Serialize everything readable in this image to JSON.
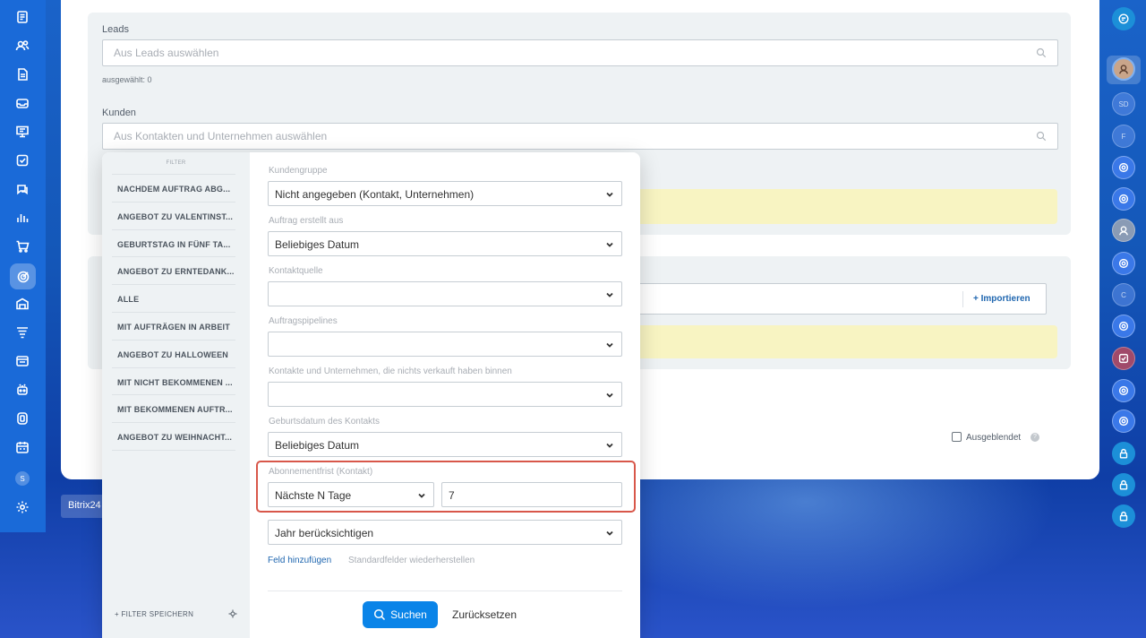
{
  "form": {
    "leads": {
      "label": "Leads",
      "placeholder": "Aus Leads auswählen",
      "selected": "ausgewählt: 0"
    },
    "kunden": {
      "label": "Kunden",
      "placeholder": "Aus Kontakten und Unternehmen auswählen"
    },
    "import_label": "+ Importieren",
    "hidden_label": "Ausgeblendet"
  },
  "bitrix_label": "Bitrix24",
  "filter": {
    "header": "FILTER",
    "presets": [
      "NACHDEM AUFTRAG ABG...",
      "ANGEBOT ZU VALENTINST...",
      "GEBURTSTAG IN FÜNF TA...",
      "ANGEBOT ZU ERNTEDANK...",
      "ALLE",
      "MIT AUFTRÄGEN IN ARBEIT",
      "ANGEBOT ZU HALLOWEEN",
      "MIT NICHT BEKOMMENEN ...",
      "MIT BEKOMMENEN AUFTR...",
      "ANGEBOT ZU WEIHNACHT..."
    ],
    "save_label": "+ FILTER SPEICHERN",
    "fields": [
      {
        "label": "Kundengruppe",
        "value": "Nicht angegeben (Kontakt, Unternehmen)"
      },
      {
        "label": "Auftrag erstellt aus",
        "value": "Beliebiges Datum"
      },
      {
        "label": "Kontaktquelle",
        "value": ""
      },
      {
        "label": "Auftragspipelines",
        "value": ""
      },
      {
        "label": "Kontakte und Unternehmen, die nichts verkauft haben binnen",
        "value": ""
      },
      {
        "label": "Geburtsdatum des Kontakts",
        "value": "Beliebiges Datum"
      }
    ],
    "subscription": {
      "label": "Abonnementfrist (Kontakt)",
      "period": "Nächste N Tage",
      "days": "7"
    },
    "year": "Jahr berücksichtigen",
    "add_field": "Feld hinzufügen",
    "restore": "Standardfelder wiederherstellen",
    "search": "Suchen",
    "reset": "Zurücksetzen"
  },
  "right_avatars": [
    "SD",
    "F",
    "C"
  ],
  "sidebar_letter": "S",
  "colors": {
    "accent": "#0a84e8",
    "highlight": "#d8574a",
    "link": "#2067b0"
  }
}
